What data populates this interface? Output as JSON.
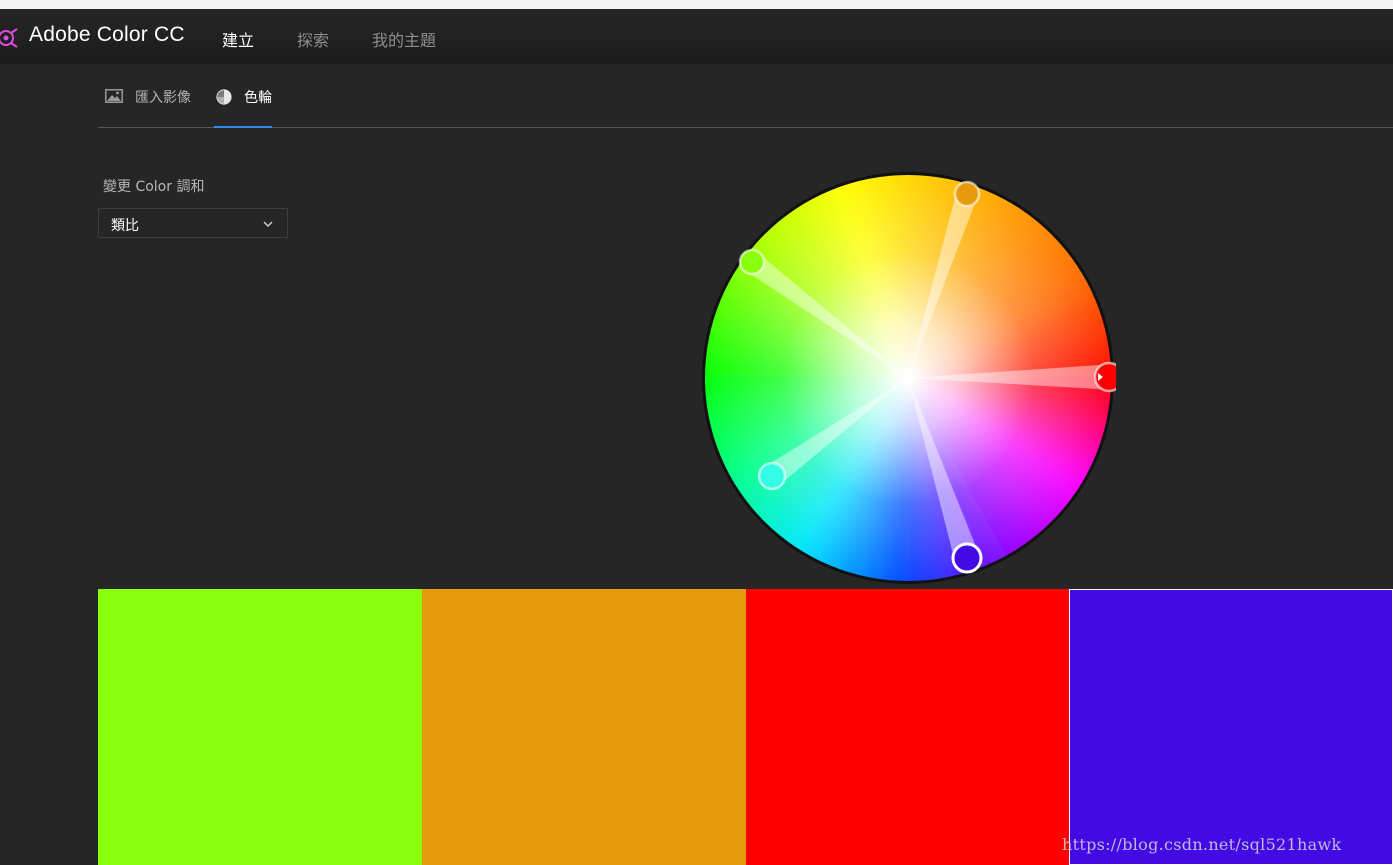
{
  "header": {
    "app_title": "Adobe Color CC",
    "nav": [
      {
        "label": "建立",
        "active": true
      },
      {
        "label": "探索",
        "active": false
      },
      {
        "label": "我的主題",
        "active": false
      }
    ],
    "logo_icon": "adobe-color-logo-icon"
  },
  "tabs": [
    {
      "label": "匯入影像",
      "icon": "image-icon",
      "active": false
    },
    {
      "label": "色輪",
      "icon": "color-wheel-icon",
      "active": true
    }
  ],
  "harmony": {
    "label": "變更 Color 調和",
    "selected": "類比"
  },
  "colors": {
    "accent": "#2d8ceb",
    "background": "#262626"
  },
  "color_wheel": {
    "markers": [
      {
        "color": "#8aff0c"
      },
      {
        "color": "#e69b0c"
      },
      {
        "color": "#ff0000"
      },
      {
        "color": "#430ae6"
      },
      {
        "color": "#33ffe6"
      }
    ]
  },
  "swatches": [
    {
      "color": "#8aff0c",
      "selected": false
    },
    {
      "color": "#e69b0c",
      "selected": false
    },
    {
      "color": "#ff0000",
      "selected": false
    },
    {
      "color": "#430ae6",
      "selected": true
    }
  ],
  "watermark": "https://blog.csdn.net/sql521hawk"
}
